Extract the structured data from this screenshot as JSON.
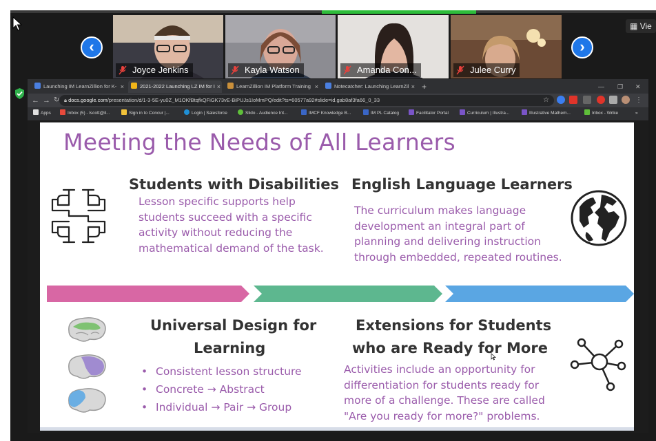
{
  "zoom": {
    "view_label": "Vie",
    "participants": [
      {
        "name": "Joyce Jenkins"
      },
      {
        "name": "Kayla Watson"
      },
      {
        "name": "Amanda Con..."
      },
      {
        "name": "Julee Curry"
      }
    ]
  },
  "browser": {
    "tabs": [
      {
        "label": "Launching IM LearnZillion for K-",
        "close": "×",
        "color": "#4a7fe0"
      },
      {
        "label": "2021-2022 Launching LZ IM for I",
        "close": "×",
        "color": "#f2b619"
      },
      {
        "label": "LearnZillion IM Platform Training",
        "close": "×",
        "color": "#c98f3a"
      },
      {
        "label": "Notecatcher: Launching LearnZil",
        "close": "×",
        "color": "#4a7fe0"
      }
    ],
    "new_tab": "+",
    "window_controls": [
      "—",
      "❐",
      "✕"
    ],
    "url_host": "docs.google.com",
    "url_path": "/presentation/d/1-3-5E-yu0Z_M1OKfBtqfkQFiGK73vE-BiPUJs1IoMmPQ/edit?ts=60577a92#slide=id.gab8af3fa66_0_33",
    "bookmarks": [
      {
        "label": "Apps",
        "color": "#e0e0e0"
      },
      {
        "label": "Inbox (5) - lscott@il...",
        "color": "#e84a3c"
      },
      {
        "label": "Sign in to Concur |...",
        "color": "#f2c23a"
      },
      {
        "label": "Login | Salesforce",
        "color": "#1f8fd6"
      },
      {
        "label": "Slido - Audience Int...",
        "color": "#5fbf3a"
      },
      {
        "label": "IMCF Knowledge B...",
        "color": "#3a66c6"
      },
      {
        "label": "IM PL Catalog",
        "color": "#3a66c6"
      },
      {
        "label": "Facilitator Portal",
        "color": "#7a55c8"
      },
      {
        "label": "Curriculum | Illustra...",
        "color": "#7a55c8"
      },
      {
        "label": "Illustrative Mathem...",
        "color": "#7a55c8"
      },
      {
        "label": "Inbox - Wrike",
        "color": "#5fbf3a"
      },
      {
        "label": "»",
        "color": "#2f3033"
      }
    ]
  },
  "slide": {
    "title": "Meeting the Needs of All Learners",
    "q1": {
      "heading": "Students with Disabilities",
      "body": "Lesson specific supports help students succeed with a specific activity without reducing the mathematical demand of the task."
    },
    "q2": {
      "heading": "English Language Learners",
      "body": "The curriculum makes language development an integral part of planning and delivering instruction through embedded, repeated routines."
    },
    "q3": {
      "heading_line1": "Universal Design for",
      "heading_line2": "Learning",
      "bullets": [
        "Consistent lesson structure",
        "Concrete → Abstract",
        "Individual → Pair → Group"
      ]
    },
    "q4": {
      "heading_line1": "Extensions for Students",
      "heading_line2": "who are Ready for More",
      "body": "Activities include an opportunity for differentiation for students ready for more of a challenge. These are called \"Are you ready for more?\" problems."
    },
    "colors": {
      "title": "#9a5bab",
      "pink": "#d867a4",
      "green": "#5db78f",
      "blue": "#5aa6e3"
    }
  }
}
